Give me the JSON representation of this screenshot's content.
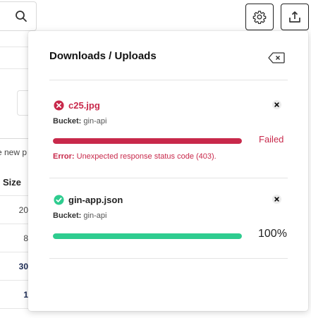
{
  "background": {
    "new_path_text": "e new p",
    "column_header": "Size",
    "rows": [
      "20",
      "8",
      "30",
      "1"
    ]
  },
  "toolbar": {
    "settings_icon": "gear-icon",
    "upload_icon": "upload-icon",
    "search_icon": "search-icon"
  },
  "panel": {
    "title": "Downloads / Uploads",
    "clear_icon": "backspace-clear-icon",
    "items": [
      {
        "status": "failed",
        "name": "c25.jpg",
        "bucket_label": "Bucket:",
        "bucket": "gin-api",
        "progress_percent": 100,
        "status_text": "Failed",
        "error_label": "Error:",
        "error_text": "Unexpected response status code (403).",
        "bar_color": "#c8294b"
      },
      {
        "status": "success",
        "name": "gin-app.json",
        "bucket_label": "Bucket:",
        "bucket": "gin-api",
        "progress_percent": 100,
        "status_text": "100%",
        "bar_color": "#2ecc8f"
      }
    ]
  },
  "colors": {
    "error": "#c8294b",
    "success": "#2ecc8f",
    "navy": "#1c2b55"
  }
}
